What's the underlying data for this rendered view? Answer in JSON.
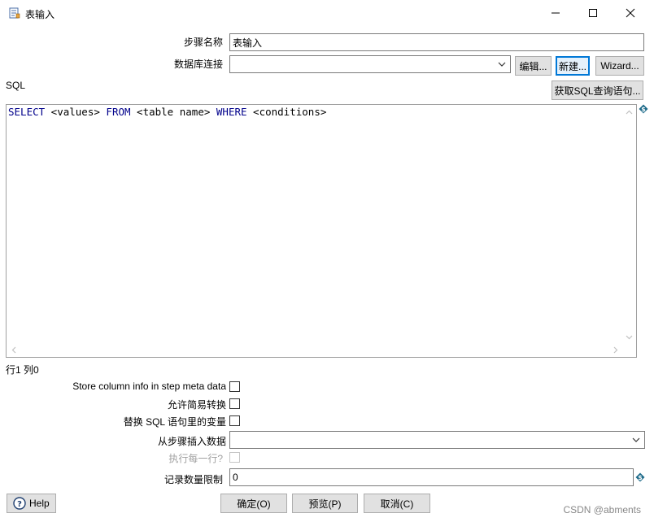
{
  "window": {
    "title": "表输入"
  },
  "form": {
    "step_name_label": "步骤名称",
    "step_name_value": "表输入",
    "db_connection_label": "数据库连接",
    "db_connection_value": "",
    "edit_button": "编辑...",
    "new_button": "新建...",
    "wizard_button": "Wizard...",
    "sql_label": "SQL",
    "get_sql_button": "获取SQL查询语句..."
  },
  "sql_editor": {
    "tokens": [
      {
        "text": "SELECT",
        "type": "keyword"
      },
      {
        "text": " <values> ",
        "type": "text"
      },
      {
        "text": "FROM",
        "type": "keyword"
      },
      {
        "text": " <table name> ",
        "type": "text"
      },
      {
        "text": "WHERE",
        "type": "keyword"
      },
      {
        "text": " <conditions>",
        "type": "text"
      }
    ],
    "cursor_status": "行1 列0"
  },
  "options": {
    "store_column_info_label": "Store column info in step meta data",
    "store_column_info_checked": false,
    "lazy_conversion_label": "允许简易转换",
    "lazy_conversion_checked": false,
    "replace_variables_label": "替换 SQL 语句里的变量",
    "replace_variables_checked": false,
    "insert_data_from_step_label": "从步骤插入数据",
    "insert_data_from_step_value": "",
    "execute_each_row_label": "执行每一行?",
    "execute_each_row_checked": false,
    "limit_label": "记录数量限制",
    "limit_value": "0"
  },
  "footer": {
    "help_button": "Help",
    "ok_button": "确定(O)",
    "preview_button": "预览(P)",
    "cancel_button": "取消(C)",
    "watermark": "CSDN @abments"
  },
  "colors": {
    "keyword": "#00008b",
    "focus_border": "#0078d7",
    "button_bg": "#e1e1e1",
    "variable_icon": "#1e6b8a"
  },
  "icons": {
    "app": "table-input-icon",
    "variable": "dollar-variable-icon",
    "help": "question-circle-icon"
  }
}
